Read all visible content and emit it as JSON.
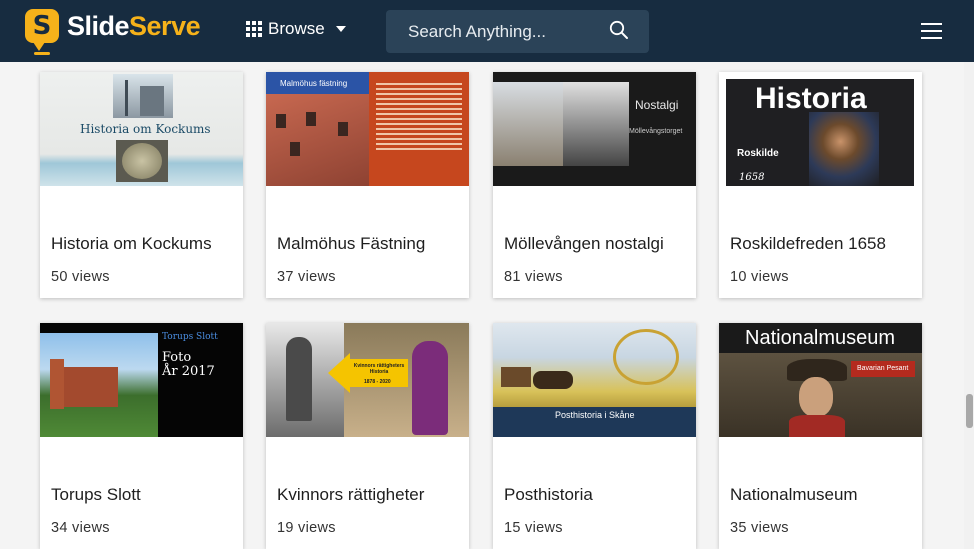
{
  "site": {
    "brand_part1": "Slide",
    "brand_part2": "Serve",
    "logo_glyph": "S"
  },
  "nav": {
    "browse_label": "Browse",
    "search_placeholder": "Search Anything..."
  },
  "colors": {
    "topbar": "#172c40",
    "accent": "#f6b21a",
    "search_bg": "#2b4358"
  },
  "icons": [
    "grid-icon",
    "chevron-down-icon",
    "search-icon",
    "hamburger-menu-icon"
  ],
  "cards": [
    {
      "title": "Historia om Kockums",
      "views": "50 views",
      "thumb_text": "Historia om Kockums"
    },
    {
      "title": "Malmöhus Fästning",
      "views": "37 views",
      "thumb_text": "Malmöhus fästning"
    },
    {
      "title": "Möllevången nostalgi",
      "views": "81 views",
      "thumb_text": "Nostalgi",
      "thumb_sub": "Möllevångstorget"
    },
    {
      "title": "Roskildefreden 1658",
      "views": "10 views",
      "thumb_text": "Historia",
      "thumb_sub": "Roskilde",
      "thumb_year": "1658"
    },
    {
      "title": "Torups Slott",
      "views": "34 views",
      "thumb_text": "Torups Slott",
      "thumb_sub": "Foto",
      "thumb_year": "År 2017"
    },
    {
      "title": "Kvinnors rättigheter",
      "views": "19 views",
      "thumb_text": "Kvinnors rättigheters Historia",
      "thumb_sub": "1878 - 2020"
    },
    {
      "title": "Posthistoria",
      "views": "15 views",
      "thumb_text": "Posthistoria i Skåne"
    },
    {
      "title": "Nationalmuseum",
      "views": "35 views",
      "thumb_text": "Nationalmuseum",
      "thumb_sub": "Bavarian Pesant"
    }
  ]
}
